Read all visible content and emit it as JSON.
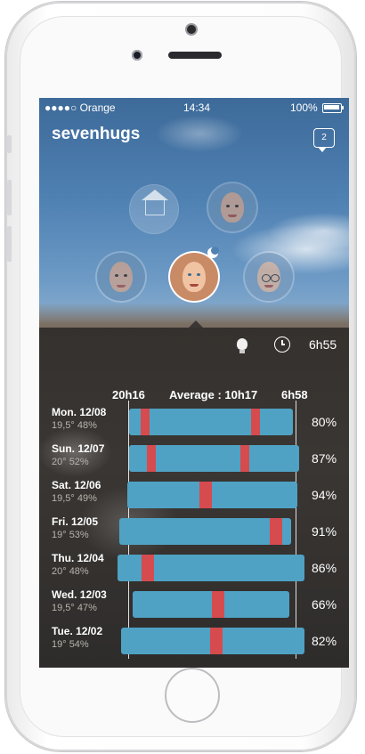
{
  "status_bar": {
    "carrier": "●●●●○ Orange",
    "time": "14:34",
    "battery": "100%"
  },
  "app": {
    "brand": "sevenhugs",
    "chat_badge": "2"
  },
  "controls": {
    "alarm_time": "6h55"
  },
  "chart_data": {
    "type": "bar",
    "header": {
      "start": "20h16",
      "average_label": "Average : 10h17",
      "end": "6h58"
    },
    "rows": [
      {
        "day": "Mon. 12/08",
        "weather": "19,5° 48%",
        "pct": "80%",
        "start": 0.06,
        "end": 0.94,
        "marks": [
          0.15,
          0.74
        ]
      },
      {
        "day": "Sun. 12/07",
        "weather": "20° 52%",
        "pct": "87%",
        "start": 0.06,
        "end": 0.97,
        "marks": [
          0.18,
          0.68
        ]
      },
      {
        "day": "Sat. 12/06",
        "weather": "19,5° 49%",
        "pct": "94%",
        "start": 0.05,
        "end": 0.96,
        "marks": [
          0.46
        ]
      },
      {
        "day": "Fri. 12/05",
        "weather": "19° 53%",
        "pct": "91%",
        "start": 0.01,
        "end": 0.93,
        "marks": [
          0.84
        ]
      },
      {
        "day": "Thu. 12/04",
        "weather": "20° 48%",
        "pct": "86%",
        "start": 0.0,
        "end": 1.0,
        "marks": [
          0.15
        ]
      },
      {
        "day": "Wed. 12/03",
        "weather": "19,5° 47%",
        "pct": "66%",
        "start": 0.08,
        "end": 0.92,
        "marks": [
          0.53
        ]
      },
      {
        "day": "Tue. 12/02",
        "weather": "19° 54%",
        "pct": "82%",
        "start": 0.02,
        "end": 1.0,
        "marks": [
          0.52
        ]
      }
    ]
  },
  "colors": {
    "bar": "#4fa2c4",
    "mark": "#d64b4e"
  }
}
